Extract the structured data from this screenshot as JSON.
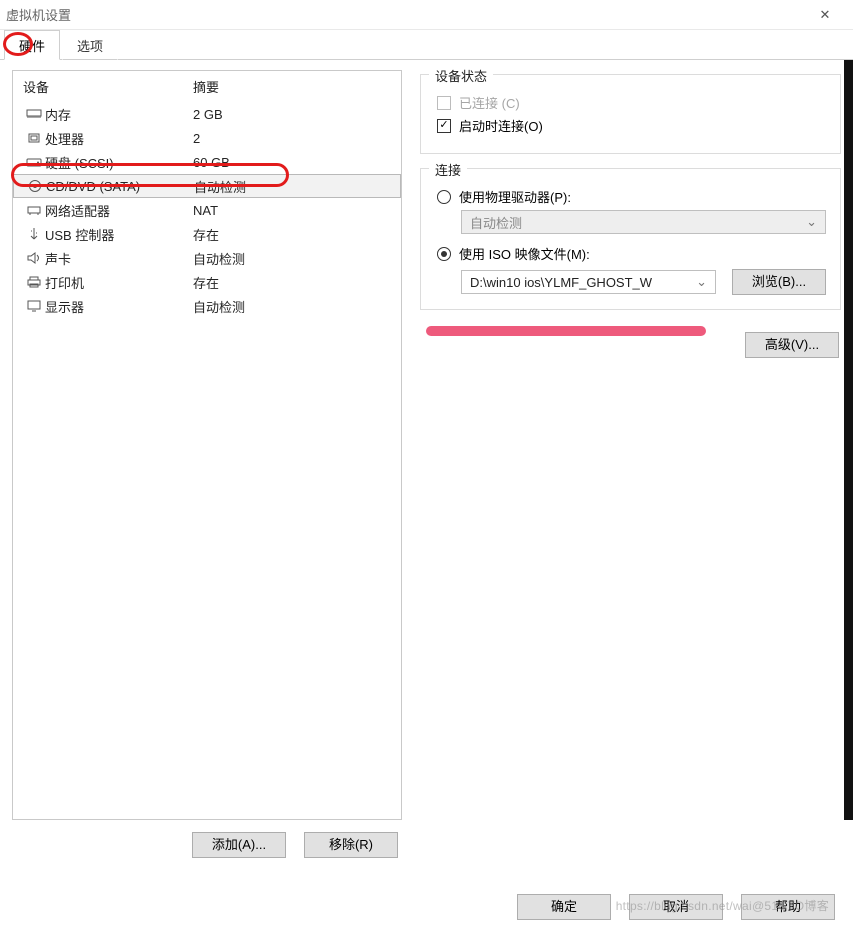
{
  "window": {
    "title": "虚拟机设置",
    "close_glyph": "✕"
  },
  "tabs": {
    "hardware": "硬件",
    "options": "选项"
  },
  "columns": {
    "device": "设备",
    "summary": "摘要"
  },
  "devices": [
    {
      "name": "内存",
      "summary": "2 GB"
    },
    {
      "name": "处理器",
      "summary": "2"
    },
    {
      "name": "硬盘 (SCSI)",
      "summary": "60 GB"
    },
    {
      "name": "CD/DVD (SATA)",
      "summary": "自动检测"
    },
    {
      "name": "网络适配器",
      "summary": "NAT"
    },
    {
      "name": "USB 控制器",
      "summary": "存在"
    },
    {
      "name": "声卡",
      "summary": "自动检测"
    },
    {
      "name": "打印机",
      "summary": "存在"
    },
    {
      "name": "显示器",
      "summary": "自动检测"
    }
  ],
  "left_buttons": {
    "add": "添加(A)...",
    "remove": "移除(R)"
  },
  "status_group": {
    "legend": "设备状态",
    "connected": "已连接 (C)",
    "connect_at_poweron": "启动时连接(O)"
  },
  "connection_group": {
    "legend": "连接",
    "physical": "使用物理驱动器(P):",
    "physical_value": "自动检测",
    "iso": "使用 ISO 映像文件(M):",
    "iso_value": "D:\\win10 ios\\YLMF_GHOST_W",
    "browse": "浏览(B)..."
  },
  "advanced": "高级(V)...",
  "footer": {
    "ok": "确定",
    "cancel": "取消",
    "help": "帮助"
  },
  "watermark": "https://blog.csdn.net/wai@51CTO博客"
}
